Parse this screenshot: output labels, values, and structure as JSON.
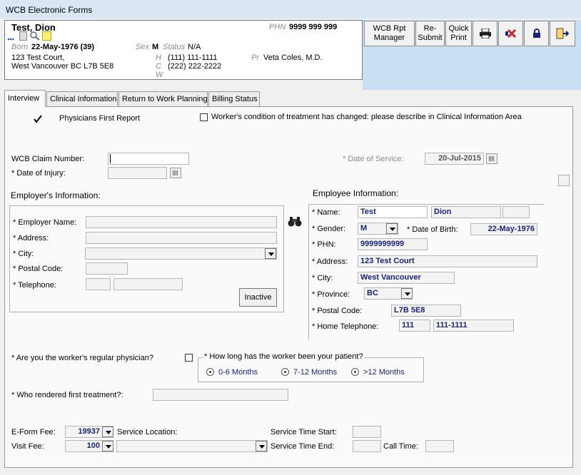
{
  "window": {
    "title": "WCB Electronic Forms"
  },
  "patient": {
    "name": "Test, Dion",
    "phn_label": "PHN",
    "phn_value": "9999 999 999",
    "born_label": "Born",
    "born_value": "22-May-1976 (39)",
    "sex_label": "Sex",
    "sex_value": "M",
    "status_label": "Status",
    "status_value": "N/A",
    "address_line1": "123 Test Court,",
    "address_line2": "West Vancouver BC  L7B 5E8",
    "phone_h_label": "H",
    "phone_h": "(111) 111-1111",
    "phone_c_label": "C",
    "phone_c": "(222) 222-2222",
    "phone_w_label": "W",
    "pr_label": "Pr",
    "provider": "Veta Coles, M.D."
  },
  "toolbar": {
    "rpt_line1": "WCB Rpt",
    "rpt_line2": "Manager",
    "resubmit_line1": "Re-",
    "resubmit_line2": "Submit",
    "quick_line1": "Quick",
    "quick_line2": "Print"
  },
  "tabs": [
    {
      "label": "Interview"
    },
    {
      "label": "Clinical Information"
    },
    {
      "label": "Return to Work Planning"
    },
    {
      "label": "Billing Status"
    }
  ],
  "form": {
    "physicians_first_report": "Physicians First Report",
    "condition_changed": "Worker's condition of treatment has changed: please describe in Clinical Information Area",
    "claim_number_label": "WCB Claim Number:",
    "date_of_service_label": "* Date of Service:",
    "date_of_service": "20-Jul-2015",
    "date_of_injury_label": "* Date of Injury:"
  },
  "employer": {
    "heading": "Employer's Information:",
    "name_label": "* Employer Name:",
    "address_label": "* Address:",
    "city_label": "* City:",
    "postal_label": "* Postal Code:",
    "telephone_label": "* Telephone:",
    "inactive_button": "Inactive"
  },
  "employee": {
    "heading": "Employee Information:",
    "name_label": "* Name:",
    "first_name": "Test",
    "last_name": "Dion",
    "gender_label": "* Gender:",
    "gender": "M",
    "dob_label": "* Date of Birth:",
    "dob": "22-May-1976",
    "phn_label": "* PHN:",
    "phn": "9999999999",
    "address_label": "* Address:",
    "address": "123 Test Court",
    "city_label": "* City:",
    "city": "West Vancouver",
    "province_label": "* Province:",
    "province": "BC",
    "postal_label": "* Postal Code:",
    "postal": "L7B 5E8",
    "home_tel_label": "* Home Telephone:",
    "area_code": "111",
    "phone": "111-1111"
  },
  "physician": {
    "regular_label": "* Are you the worker's regular physician?",
    "how_long_label": "* How long has the worker been your patient?",
    "opt1": "0-6 Months",
    "opt2": "7-12 Months",
    "opt3": ">12 Months",
    "first_treatment_label": "* Who rendered first treatment?:"
  },
  "billing": {
    "eform_fee_label": "E-Form Fee:",
    "eform_fee": "19937",
    "service_location_label": "Service Location:",
    "service_time_start_label": "Service Time Start:",
    "visit_fee_label": "Visit Fee:",
    "visit_fee": "100",
    "service_time_end_label": "Service Time End:",
    "call_time_label": "Call Time:"
  },
  "colors": {
    "title_bar": "#dbe6f4",
    "toolbar_band": "#c9dff2",
    "value_text": "#1a237e",
    "patient_value": "#1a237e"
  }
}
